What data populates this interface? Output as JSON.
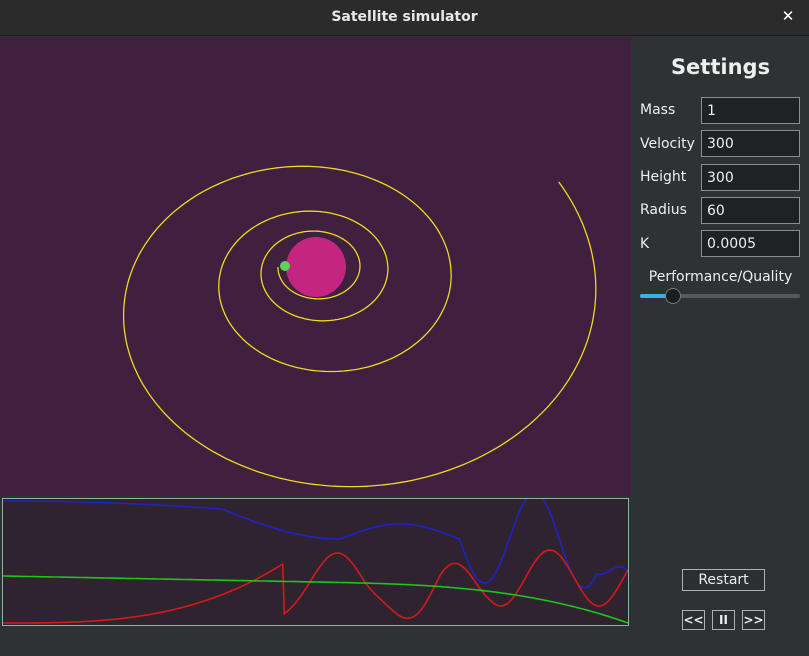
{
  "window": {
    "title": "Satellite simulator",
    "close_glyph": "✕"
  },
  "simulation": {
    "background_color": "#3f203f",
    "planet_color": "#c4267f",
    "satellite_color": "#5fd35f",
    "trajectory_color": "#f0d820"
  },
  "graph": {
    "background_color": "#2f2330",
    "border_color": "#8fb69a",
    "series_colors": [
      "#1e22c8",
      "#d41a1a",
      "#1cc41c"
    ]
  },
  "settings": {
    "title": "Settings",
    "fields": [
      {
        "label": "Mass",
        "value": "1"
      },
      {
        "label": "Velocity",
        "value": "300"
      },
      {
        "label": "Height",
        "value": "300"
      },
      {
        "label": "Radius",
        "value": "60"
      },
      {
        "label": "K",
        "value": "0.0005"
      }
    ],
    "slider": {
      "label": "Performance/Quality",
      "level": 0.2,
      "accent_color": "#3daee9"
    },
    "restart_label": "Restart",
    "prev_label": "<<",
    "pause_label": "II",
    "next_label": ">>"
  }
}
